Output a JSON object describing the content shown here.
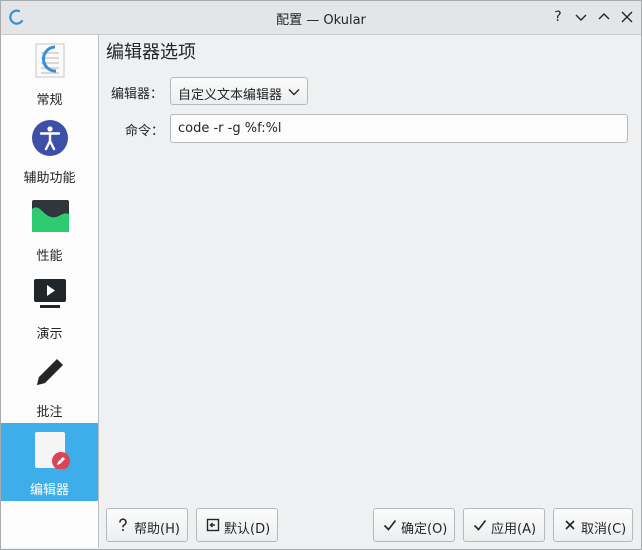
{
  "window": {
    "title": "配置 — Okular",
    "help_glyph": "?"
  },
  "sidebar": {
    "items": [
      {
        "label": "常规",
        "icon": "document-icon"
      },
      {
        "label": "辅助功能",
        "icon": "accessibility-icon"
      },
      {
        "label": "性能",
        "icon": "performance-icon"
      },
      {
        "label": "演示",
        "icon": "presentation-icon"
      },
      {
        "label": "批注",
        "icon": "pencil-icon"
      },
      {
        "label": "编辑器",
        "icon": "editor-icon"
      }
    ],
    "active_index": 5
  },
  "main": {
    "heading": "编辑器选项",
    "editor_label": "编辑器：",
    "editor_value": "自定义文本编辑器",
    "command_label": "命令：",
    "command_value": "code -r -g %f:%l"
  },
  "buttons": {
    "help": "帮助(H)",
    "defaults": "默认(D)",
    "ok": "确定(O)",
    "apply": "应用(A)",
    "cancel": "取消(C)"
  },
  "colors": {
    "accent": "#3daee9",
    "sidebar_bg": "#fcfcfc",
    "window_bg": "#eff0f1"
  }
}
